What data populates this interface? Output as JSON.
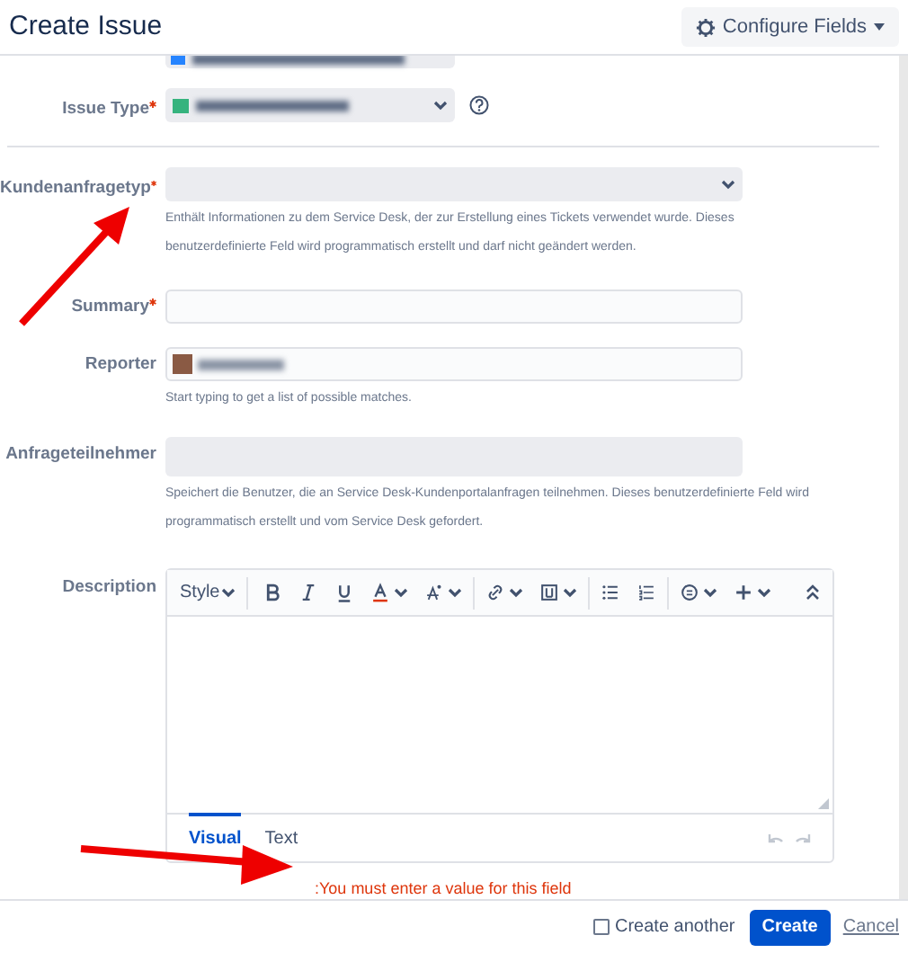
{
  "dialog": {
    "title": "Create Issue",
    "configure_button": "Configure Fields"
  },
  "fields": [
    {
      "kind": "project"
    },
    {
      "kind": "select",
      "label": "Issue Type",
      "required": true,
      "redacted": true,
      "help_icon": true
    },
    {
      "kind": "select",
      "label": "Kundenanfragetyp",
      "required": true,
      "help": "Enthält Informationen zu dem Service Desk, der zur Erstellung eines Tickets verwendet wurde. Dieses benutzerdefinierte Feld wird programmatisch erstellt und darf nicht geändert werden."
    },
    {
      "kind": "text",
      "label": "Summary",
      "required": true
    },
    {
      "kind": "user",
      "label": "Reporter",
      "required": false,
      "help": "Start typing to get a list of possible matches."
    },
    {
      "kind": "disabled",
      "label": "Anfrageteilnehmer",
      "required": false,
      "help": "Speichert die Benutzer, die an Service Desk-Kundenportalanfragen teilnehmen. Dieses benutzerdefinierte Feld wird programmatisch erstellt und vom Service Desk gefordert."
    },
    {
      "kind": "editor",
      "label": "Description",
      "required": false,
      "style_menu": "Style",
      "tabs": [
        {
          "label": "Visual",
          "selected": true
        },
        {
          "label": "Text",
          "selected": false
        }
      ]
    }
  ],
  "error": ":You must enter a value for this field",
  "footer": {
    "create_another": {
      "label": "Create another",
      "checked": false
    },
    "create_button": "Create",
    "cancel_link": "Cancel"
  }
}
